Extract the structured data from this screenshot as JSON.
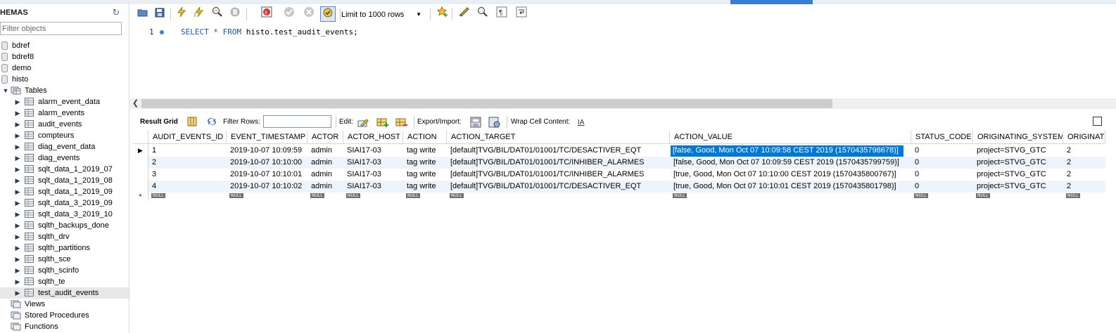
{
  "sidebar": {
    "title": "HEMAS",
    "filter_placeholder": "Filter objects",
    "schemas": [
      "bdref",
      "bdref8",
      "demo",
      "histo"
    ],
    "tables_label": "Tables",
    "tables": [
      "alarm_event_data",
      "alarm_events",
      "audit_events",
      "compteurs",
      "diag_event_data",
      "diag_events",
      "sqlt_data_1_2019_07",
      "sqlt_data_1_2019_08",
      "sqlt_data_1_2019_09",
      "sqlt_data_3_2019_09",
      "sqlt_data_3_2019_10",
      "sqlth_backups_done",
      "sqlth_drv",
      "sqlth_partitions",
      "sqlth_sce",
      "sqlth_scinfo",
      "sqlth_te",
      "test_audit_events"
    ],
    "selected_table": "test_audit_events",
    "folders": [
      "Views",
      "Stored Procedures",
      "Functions"
    ]
  },
  "toolbar": {
    "limit_label": "Limit to 1000 rows",
    "icons": [
      "open-folder-icon",
      "save-icon",
      "execute-icon",
      "execute-current-icon",
      "explain-icon",
      "stop-icon",
      "toggle-error-icon",
      "commit-icon",
      "rollback-icon",
      "autocommit-icon",
      "bookmark-icon",
      "beautify-icon",
      "find-icon",
      "invisible-chars-icon",
      "wrap-icon"
    ]
  },
  "editor": {
    "line_number": "1",
    "sql_kw1": "SELECT",
    "sql_star": " * ",
    "sql_kw2": "FROM",
    "sql_rest": " histo.test_audit_events;"
  },
  "result_toolbar": {
    "result_grid_label": "Result Grid",
    "filter_rows_label": "Filter Rows:",
    "edit_label": "Edit:",
    "export_label": "Export/Import:",
    "wrap_label": "Wrap Cell Content:"
  },
  "grid": {
    "columns": [
      "AUDIT_EVENTS_ID",
      "EVENT_TIMESTAMP",
      "ACTOR",
      "ACTOR_HOST",
      "ACTION",
      "ACTION_TARGET",
      "ACTION_VALUE",
      "STATUS_CODE",
      "ORIGINATING_SYSTEM",
      "ORIGINATI"
    ],
    "rows": [
      [
        "1",
        "2019-10-07 10:09:59",
        "admin",
        "SIAI17-03",
        "tag write",
        "[default]TVG/BIL/DAT01/01001/TC/DESACTIVER_EQT",
        "[false, Good, Mon Oct 07 10:09:58 CEST 2019 (1570435798678)]",
        "0",
        "project=STVG_GTC",
        "2"
      ],
      [
        "2",
        "2019-10-07 10:10:00",
        "admin",
        "SIAI17-03",
        "tag write",
        "[default]TVG/BIL/DAT01/01001/TC/INHIBER_ALARMES",
        "[false, Good, Mon Oct 07 10:09:59 CEST 2019 (1570435799759)]",
        "0",
        "project=STVG_GTC",
        "2"
      ],
      [
        "3",
        "2019-10-07 10:10:01",
        "admin",
        "SIAI17-03",
        "tag write",
        "[default]TVG/BIL/DAT01/01001/TC/INHIBER_ALARMES",
        "[true, Good, Mon Oct 07 10:10:00 CEST 2019 (1570435800767)]",
        "0",
        "project=STVG_GTC",
        "2"
      ],
      [
        "4",
        "2019-10-07 10:10:02",
        "admin",
        "SIAI17-03",
        "tag write",
        "[default]TVG/BIL/DAT01/01001/TC/DESACTIVER_EQT",
        "[true, Good, Mon Oct 07 10:10:01 CEST 2019 (1570435801798)]",
        "0",
        "project=STVG_GTC",
        "2"
      ]
    ],
    "null_label": "NULL",
    "new_row_marker": "*",
    "current_row_marker": "▶"
  },
  "colors": {
    "keyword": "#1458c7",
    "selection": "#0078d7",
    "alt_row": "#eef4fb"
  }
}
